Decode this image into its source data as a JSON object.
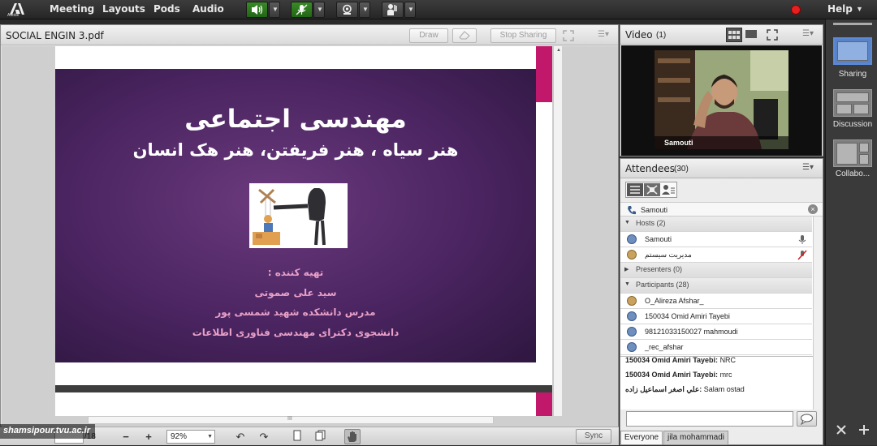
{
  "topbar": {
    "brand": "Adobe",
    "menus": [
      "Meeting",
      "Layouts",
      "Pods",
      "Audio"
    ],
    "help": "Help",
    "icons": [
      "speaker-icon",
      "microphone-muted-icon",
      "webcam-icon",
      "raise-hand-icon"
    ],
    "record_color": "#e62020",
    "speaker_active_color": "#2e8a1e"
  },
  "share_pod": {
    "title": "SOCIAL ENGIN 3.pdf",
    "draw_label": "Draw",
    "stop_sharing_label": "Stop Sharing"
  },
  "slide": {
    "title": "مهندسی اجتماعی",
    "subtitle": "هنر سیاه ، هنر فریفتن، هنر هک انسان",
    "prepared_by": "تهیه کننده :",
    "author": "سید علی صموتی",
    "position": "مدرس دانشکده شهید شمسی پور",
    "degree": "دانشجوی دکترای مهندسی فناوری اطلاعات",
    "bg_color": "#4a2460",
    "text_color": "#ffffff",
    "pink_text_color": "#e8a0c8",
    "accent_color": "#c2186b"
  },
  "doc_toolbar": {
    "page_total": "/18",
    "zoom": "92%",
    "sync_label": "Sync",
    "scroll_marker": "III"
  },
  "video_pod": {
    "title": "Video",
    "count": "(1)",
    "speaker_name": "Samouti"
  },
  "attendees_pod": {
    "title": "Attendees",
    "count": "(30)",
    "active_speaker": "Samouti",
    "hosts_label": "Hosts (2)",
    "hosts": [
      "Samouti",
      "مدیریت سیستم"
    ],
    "presenters_label": "Presenters (0)",
    "participants_label": "Participants (28)",
    "participants": [
      "O_Alireza Afshar_",
      "150034 Omid Amiri Tayebi",
      "98121033150027 mahmoudi",
      "_rec_afshar"
    ]
  },
  "chat": {
    "messages": [
      {
        "sender": "150034 Omid Amiri Tayebi:",
        "text": "NRC"
      },
      {
        "sender": "150034 Omid Amiri Tayebi:",
        "text": "mrc"
      },
      {
        "sender": "علي اصغر اسماعيل زاده:",
        "text": "Salam ostad"
      }
    ],
    "tabs": [
      "Everyone",
      "jila mohammadi"
    ]
  },
  "layouts_rail": {
    "items": [
      "Sharing",
      "Discussion",
      "Collabo..."
    ]
  },
  "watermark": "shamsipour.tvu.ac.ir"
}
